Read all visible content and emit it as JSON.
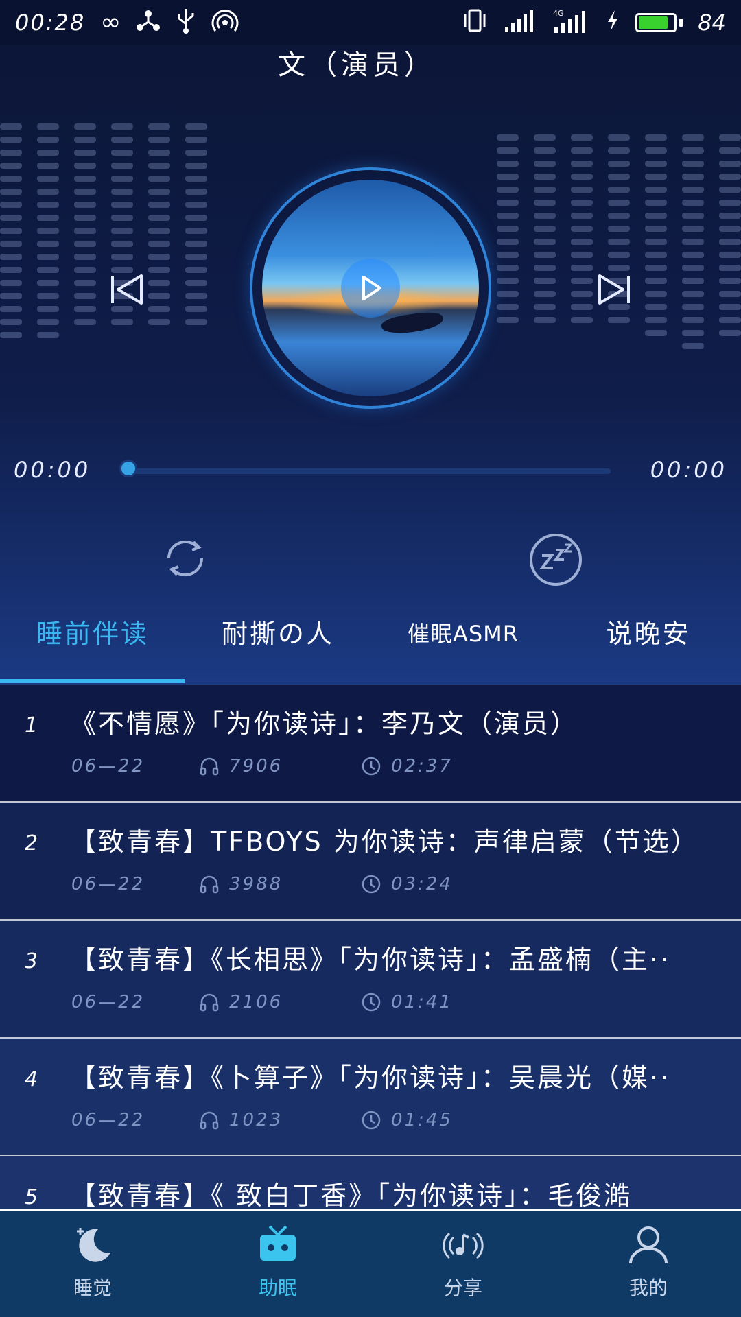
{
  "status_bar": {
    "time": "00:28",
    "battery_percent": "84",
    "battery_level": 0.84,
    "icons": [
      "infinity-icon",
      "share-node-icon",
      "usb-icon",
      "hotspot-icon",
      "vibrate-icon",
      "signal-icon",
      "signal-4g-icon",
      "charging-icon",
      "battery-icon"
    ]
  },
  "player": {
    "title_partial": "文（演员）",
    "current_time": "00:00",
    "total_time": "00:00",
    "progress": 0,
    "accent": "#3ab6f0"
  },
  "tabs": [
    {
      "label": "睡前伴读",
      "active": true
    },
    {
      "label": "耐撕の人",
      "active": false
    },
    {
      "label": "催眠ASMR",
      "active": false
    },
    {
      "label": "说晚安",
      "active": false
    }
  ],
  "list": [
    {
      "num": "1",
      "title": "《不情愿》「为你读诗」：李乃文（演员）",
      "date": "06—22",
      "plays": "7906",
      "duration": "02:37"
    },
    {
      "num": "2",
      "title": "【致青春】TFBOYS 为你读诗：声律启蒙（节选）",
      "date": "06—22",
      "plays": "3988",
      "duration": "03:24"
    },
    {
      "num": "3",
      "title": "【致青春】《长相思》「为你读诗」：孟盛楠（主··",
      "date": "06—22",
      "plays": "2106",
      "duration": "01:41"
    },
    {
      "num": "4",
      "title": "【致青春】《卜算子》「为你读诗」：吴晨光（媒··",
      "date": "06—22",
      "plays": "1023",
      "duration": "01:45"
    },
    {
      "num": "5",
      "title": "【致青春】《 致白丁香》「为你读诗」：毛俊澔",
      "date": "",
      "plays": "",
      "duration": ""
    }
  ],
  "bottom_nav": [
    {
      "label": "睡觉",
      "icon": "moon-icon",
      "active": false
    },
    {
      "label": "助眠",
      "icon": "radio-icon",
      "active": true
    },
    {
      "label": "分享",
      "icon": "music-broadcast-icon",
      "active": false
    },
    {
      "label": "我的",
      "icon": "user-icon",
      "active": false
    }
  ]
}
